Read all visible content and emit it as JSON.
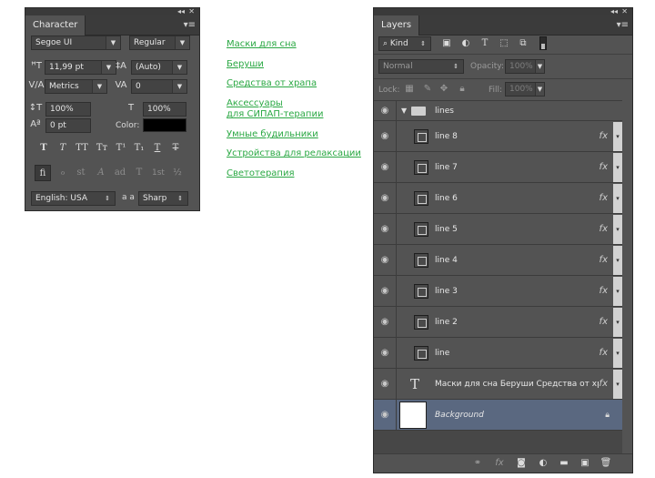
{
  "character_panel": {
    "title": "Character",
    "font_family": "Segoe UI",
    "font_style": "Regular",
    "font_size": "11,99 pt",
    "leading": "(Auto)",
    "kerning": "Metrics",
    "tracking": "0",
    "vertical_scale": "100%",
    "horizontal_scale": "100%",
    "baseline_shift": "0 pt",
    "color_label": "Color:",
    "text_color": "#000000",
    "style_buttons": [
      "T",
      "T",
      "TT",
      "Tт",
      "T¹",
      "T₁",
      "T",
      "T"
    ],
    "opentype_buttons": [
      "fi",
      "ℴ",
      "st",
      "A",
      "ad",
      "T",
      "1st",
      "½"
    ],
    "language": "English: USA",
    "aa_label": "a a",
    "antialias": "Sharp"
  },
  "links": [
    "Маски для сна",
    "Беруши",
    "Средства от храпа",
    "Аксессуары",
    "для СИПАП-терапии",
    "Умные будильники",
    "Устройства для релаксации",
    "Светотерапия"
  ],
  "layers_panel": {
    "title": "Layers",
    "filter_kind": "Kind",
    "blend_mode": "Normal",
    "opacity_label": "Opacity:",
    "opacity_value": "100%",
    "lock_label": "Lock:",
    "fill_label": "Fill:",
    "fill_value": "100%",
    "group_name": "lines",
    "fx_label": "fx",
    "layers": [
      {
        "name": "line 8"
      },
      {
        "name": "line 7"
      },
      {
        "name": "line 6"
      },
      {
        "name": "line 5"
      },
      {
        "name": "line 4"
      },
      {
        "name": "line 3"
      },
      {
        "name": "line 2"
      },
      {
        "name": "line"
      }
    ],
    "text_layer_name": "Маски для сна Беруши Средства от храп...",
    "background_layer_name": "Background"
  },
  "colors": {
    "panel_bg": "#535353",
    "link_green": "#2aa843",
    "selected_layer": "#5a6880"
  }
}
